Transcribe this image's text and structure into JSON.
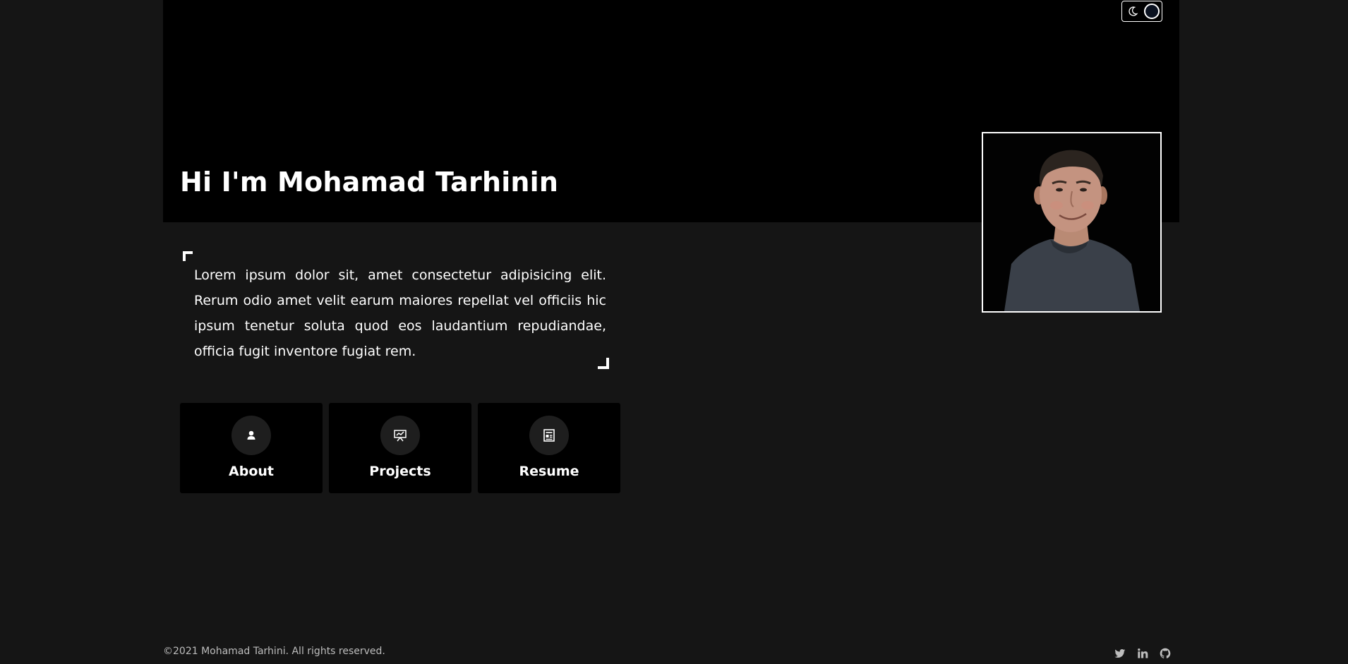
{
  "theme_toggle": {
    "icon": "moon-icon",
    "mode": "dark"
  },
  "hero": {
    "title": "Hi I'm Mohamad Tarhinin",
    "portrait_alt": "Portrait of Mohamad Tarhini"
  },
  "intro": {
    "text": "Lorem ipsum dolor sit, amet consectetur adipisicing elit. Rerum odio amet velit earum maiores repellat vel officiis hic ipsum tenetur soluta quod eos laudantium repudiandae, officia fugit inventore fugiat rem."
  },
  "nav_cards": [
    {
      "label": "About",
      "icon": "user-icon"
    },
    {
      "label": "Projects",
      "icon": "presentation-icon"
    },
    {
      "label": "Resume",
      "icon": "document-icon"
    }
  ],
  "footer": {
    "copyright": "©2021 Mohamad Tarhini. All rights reserved.",
    "socials": [
      "twitter-icon",
      "linkedin-icon",
      "github-icon"
    ]
  },
  "colors": {
    "page_background": "#151515",
    "hero_background": "#000000",
    "card_background": "#000000",
    "icon_circle": "#1e1e1e",
    "footer_text": "#bdbdbd"
  }
}
